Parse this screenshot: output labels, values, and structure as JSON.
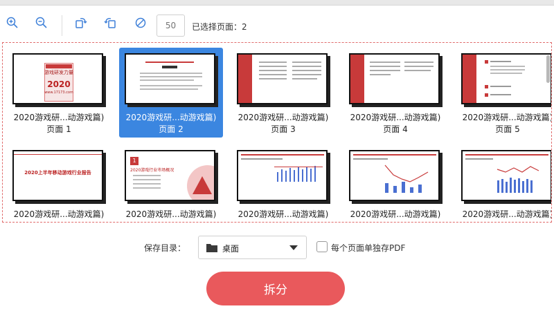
{
  "toolbar": {
    "icons": [
      "zoom-in-icon",
      "zoom-out-icon",
      "rotate-right-icon",
      "rotate-left-icon",
      "clear-icon"
    ],
    "page_input_placeholder": "50",
    "selected_info": "已选择页面：2"
  },
  "thumbnails": [
    {
      "name": "2020游戏研...动游戏篇)",
      "page": "页面 1",
      "selected": false
    },
    {
      "name": "2020游戏研...动游戏篇)",
      "page": "页面 2",
      "selected": true
    },
    {
      "name": "2020游戏研...动游戏篇)",
      "page": "页面 3",
      "selected": false
    },
    {
      "name": "2020游戏研...动游戏篇)",
      "page": "页面 4",
      "selected": false
    },
    {
      "name": "2020游戏研...动游戏篇)",
      "page": "页面 5",
      "selected": false
    },
    {
      "name": "2020游戏研...动游戏篇)",
      "page": "",
      "selected": false
    },
    {
      "name": "2020游戏研...动游戏篇)",
      "page": "",
      "selected": false
    },
    {
      "name": "2020游戏研...动游戏篇)",
      "page": "",
      "selected": false
    },
    {
      "name": "2020游戏研...动游戏篇)",
      "page": "",
      "selected": false
    },
    {
      "name": "2020游戏研...动游戏篇)",
      "page": "",
      "selected": false
    }
  ],
  "thumb_text": {
    "cover_title": "游戏研发力量",
    "cover_year": "2020",
    "cover_site": "www.17173.com",
    "page6_title": "2020上半年移动游戏行业报告",
    "page7_number": "1",
    "page7_title": "2020游戏行业市场概况"
  },
  "save": {
    "label": "保存目录：",
    "directory": "桌面",
    "checkbox_label": "每个页面单独存PDF",
    "checkbox_checked": false
  },
  "split_button": "拆分",
  "colors": {
    "accent_red": "#e9595c",
    "selected_blue": "#3b86e0",
    "doc_red": "#c83a3a"
  }
}
